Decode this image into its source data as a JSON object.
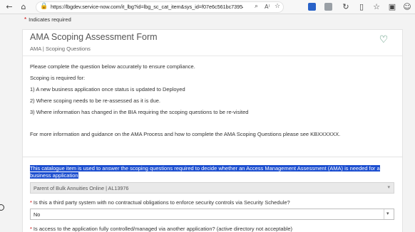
{
  "browser": {
    "url": "https://lbgdev.service-now.com/it_lbg?id=lbg_sc_cat_item&sys_id=f07e6c561bc7395409...",
    "icons": [
      "back-arrow-icon",
      "home-icon",
      "lock-icon",
      "search-icon",
      "read-aloud-icon",
      "favorite-star-icon",
      "extension-icon",
      "split-screen-icon",
      "favorites-icon",
      "collections-icon",
      "profile-icon"
    ]
  },
  "page": {
    "required_note": "Indicates required"
  },
  "form": {
    "title": "AMA Scoping Assessment Form",
    "subtitle": "AMA | Scoping Questions",
    "paragraphs": [
      "Please complete the question below accurately to ensure compliance.",
      "Scoping is required for:",
      "1) A new business application once status is updated to Deployed",
      "2) Where scoping needs to be re-assessed as it is due.",
      "3) Where information has changed in the BIA requiring the scoping questions to be re-visited",
      "For more information and guidance on the AMA Process and how to complete the AMA Scoping Questions please see KBXXXXXX."
    ],
    "catalogue_text": "This catalogue item is used to answer the scoping questions required to decide whether an Access Management Assessment (AMA) is needed for a business application",
    "application_value": "Parent of Bulk Annuities Online | AL13976",
    "question1": "Is this a third party system with no contractual obligations to enforce security controls via Security Schedule?",
    "question1_value": "No",
    "question2": "Is access to the application fully controlled/managed via another application? (active directory not acceptable)"
  },
  "colors": {
    "highlight": "#1d4fd0",
    "required": "#cc0000",
    "heart": "#2e7d5b"
  }
}
